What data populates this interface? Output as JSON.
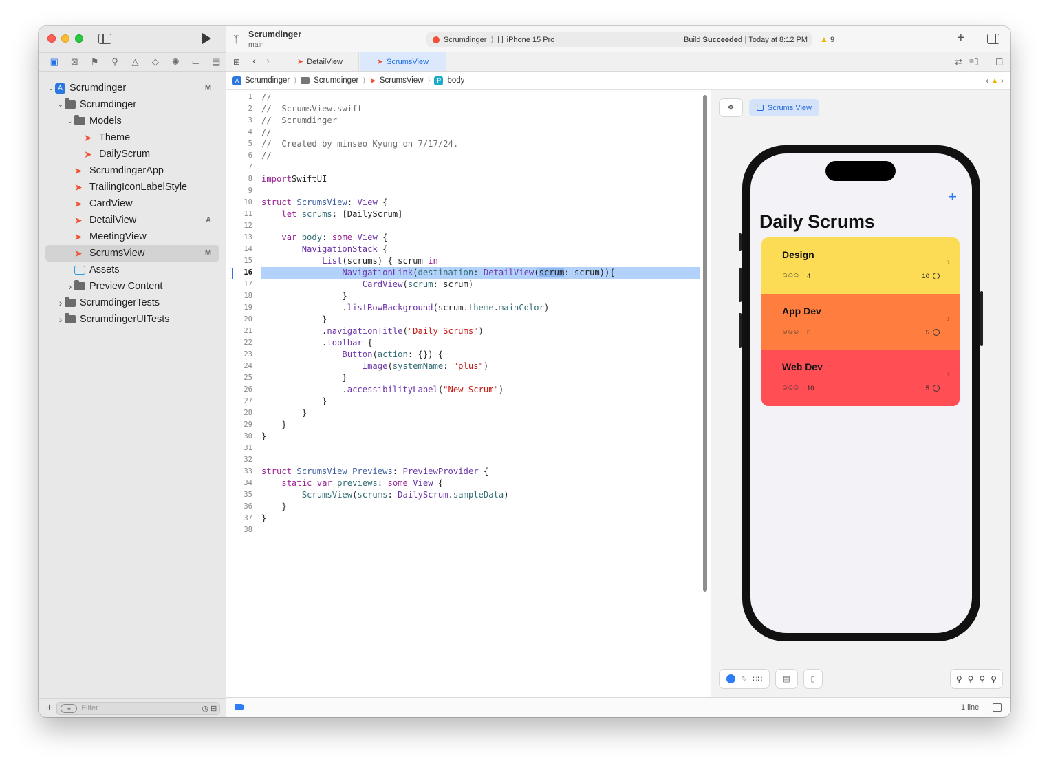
{
  "sidebar": {
    "nav_tabs": [
      "folder-icon",
      "source-control-icon",
      "bookmark-icon",
      "find-icon",
      "issues-icon",
      "tests-icon",
      "debug-icon",
      "breakpoints-icon",
      "reports-icon"
    ],
    "tree": [
      {
        "label": "Scrumdinger",
        "level": 0,
        "kind": "project",
        "badge": "M",
        "expanded": true
      },
      {
        "label": "Scrumdinger",
        "level": 1,
        "kind": "folder",
        "badge": "",
        "expanded": true
      },
      {
        "label": "Models",
        "level": 2,
        "kind": "folder",
        "badge": "",
        "expanded": true
      },
      {
        "label": "Theme",
        "level": 3,
        "kind": "swift",
        "badge": ""
      },
      {
        "label": "DailyScrum",
        "level": 3,
        "kind": "swift",
        "badge": ""
      },
      {
        "label": "ScrumdingerApp",
        "level": 2,
        "kind": "swift",
        "badge": ""
      },
      {
        "label": "TrailingIconLabelStyle",
        "level": 2,
        "kind": "swift",
        "badge": ""
      },
      {
        "label": "CardView",
        "level": 2,
        "kind": "swift",
        "badge": ""
      },
      {
        "label": "DetailView",
        "level": 2,
        "kind": "swift",
        "badge": "A"
      },
      {
        "label": "MeetingView",
        "level": 2,
        "kind": "swift",
        "badge": ""
      },
      {
        "label": "ScrumsView",
        "level": 2,
        "kind": "swift",
        "badge": "M",
        "selected": true
      },
      {
        "label": "Assets",
        "level": 2,
        "kind": "assets",
        "badge": ""
      },
      {
        "label": "Preview Content",
        "level": 2,
        "kind": "folder",
        "badge": "",
        "collapsed": true
      },
      {
        "label": "ScrumdingerTests",
        "level": 1,
        "kind": "folder",
        "badge": "",
        "collapsed": true
      },
      {
        "label": "ScrumdingerUITests",
        "level": 1,
        "kind": "folder",
        "badge": "",
        "collapsed": true
      }
    ],
    "filter_placeholder": "Filter"
  },
  "toolbar": {
    "project_name": "Scrumdinger",
    "branch": "main",
    "scheme": "Scrumdinger",
    "device": "iPhone 15 Pro",
    "status_prefix": "Build",
    "status_bold": "Succeeded",
    "status_suffix": "| Today at 8:12 PM",
    "warning_count": "9"
  },
  "tabs": [
    {
      "label": "DetailView",
      "active": false
    },
    {
      "label": "ScrumsView",
      "active": true
    }
  ],
  "jumpbar": [
    "Scrumdinger",
    "Scrumdinger",
    "ScrumsView",
    "body"
  ],
  "code_lines": [
    [
      [
        "c-cm",
        "//"
      ]
    ],
    [
      [
        "c-cm",
        "//  ScrumsView.swift"
      ]
    ],
    [
      [
        "c-cm",
        "//  Scrumdinger"
      ]
    ],
    [
      [
        "c-cm",
        "//"
      ]
    ],
    [
      [
        "c-cm",
        "//  Created by minseo Kyung on 7/17/24."
      ]
    ],
    [
      [
        "c-cm",
        "//"
      ]
    ],
    [],
    [
      [
        "c-kw",
        "import"
      ],
      [
        "",
        "SwiftUI"
      ]
    ],
    [],
    [
      [
        "c-kw",
        "struct"
      ],
      [
        "",
        " "
      ],
      [
        "c-ty",
        "ScrumsView"
      ],
      [
        "",
        ": "
      ],
      [
        "c-pr",
        "View"
      ],
      [
        "",
        " {"
      ]
    ],
    [
      [
        "",
        "    "
      ],
      [
        "c-kw",
        "let"
      ],
      [
        "",
        " "
      ],
      [
        "c-fn",
        "scrums"
      ],
      [
        "",
        ": [DailyScrum]"
      ]
    ],
    [],
    [
      [
        "",
        "    "
      ],
      [
        "c-kw",
        "var"
      ],
      [
        "",
        " "
      ],
      [
        "c-fn",
        "body"
      ],
      [
        "",
        ": "
      ],
      [
        "c-kw",
        "some"
      ],
      [
        "",
        " "
      ],
      [
        "c-pr",
        "View"
      ],
      [
        "",
        " {"
      ]
    ],
    [
      [
        "",
        "        "
      ],
      [
        "c-pr",
        "NavigationStack"
      ],
      [
        "",
        " {"
      ]
    ],
    [
      [
        "",
        "            "
      ],
      [
        "c-pr",
        "List"
      ],
      [
        "",
        "(scrums) { scrum "
      ],
      [
        "c-kw",
        "in"
      ]
    ],
    [
      [
        "",
        "                "
      ],
      [
        "c-pr",
        "NavigationLink"
      ],
      [
        "",
        "("
      ],
      [
        "c-fn",
        "destination"
      ],
      [
        "",
        ": "
      ],
      [
        "c-pr",
        "DetailView"
      ],
      [
        "",
        "("
      ],
      [
        "c-sel",
        "scrum"
      ],
      [
        "",
        ": scrum)){"
      ]
    ],
    [
      [
        "",
        "                    "
      ],
      [
        "c-pr",
        "CardView"
      ],
      [
        "",
        "("
      ],
      [
        "c-fn",
        "scrum"
      ],
      [
        "",
        ": scrum)"
      ]
    ],
    [
      [
        "",
        "                }"
      ]
    ],
    [
      [
        "",
        "                ."
      ],
      [
        "c-pr",
        "listRowBackground"
      ],
      [
        "",
        "(scrum."
      ],
      [
        "c-fn",
        "theme"
      ],
      [
        "",
        "."
      ],
      [
        "c-fn",
        "mainColor"
      ],
      [
        "",
        ")"
      ]
    ],
    [
      [
        "",
        "            }"
      ]
    ],
    [
      [
        "",
        "            ."
      ],
      [
        "c-pr",
        "navigationTitle"
      ],
      [
        "",
        "("
      ],
      [
        "c-st",
        "\"Daily Scrums\""
      ],
      [
        "",
        ")"
      ]
    ],
    [
      [
        "",
        "            ."
      ],
      [
        "c-pr",
        "toolbar"
      ],
      [
        "",
        " {"
      ]
    ],
    [
      [
        "",
        "                "
      ],
      [
        "c-pr",
        "Button"
      ],
      [
        "",
        "("
      ],
      [
        "c-fn",
        "action"
      ],
      [
        "",
        ": {}) {"
      ]
    ],
    [
      [
        "",
        "                    "
      ],
      [
        "c-pr",
        "Image"
      ],
      [
        "",
        "("
      ],
      [
        "c-fn",
        "systemName"
      ],
      [
        "",
        ": "
      ],
      [
        "c-st",
        "\"plus\""
      ],
      [
        "",
        ")"
      ]
    ],
    [
      [
        "",
        "                }"
      ]
    ],
    [
      [
        "",
        "                ."
      ],
      [
        "c-pr",
        "accessibilityLabel"
      ],
      [
        "",
        "("
      ],
      [
        "c-st",
        "\"New Scrum\""
      ],
      [
        "",
        ")"
      ]
    ],
    [
      [
        "",
        "            }"
      ]
    ],
    [
      [
        "",
        "        }"
      ]
    ],
    [
      [
        "",
        "    }"
      ]
    ],
    [
      [
        "",
        "}"
      ]
    ],
    [],
    [],
    [
      [
        "c-kw",
        "struct"
      ],
      [
        "",
        " "
      ],
      [
        "c-ty",
        "ScrumsView_Previews"
      ],
      [
        "",
        ": "
      ],
      [
        "c-pr",
        "PreviewProvider"
      ],
      [
        "",
        " {"
      ]
    ],
    [
      [
        "",
        "    "
      ],
      [
        "c-kw",
        "static"
      ],
      [
        "",
        " "
      ],
      [
        "c-kw",
        "var"
      ],
      [
        "",
        " "
      ],
      [
        "c-fn",
        "previews"
      ],
      [
        "",
        ": "
      ],
      [
        "c-kw",
        "some"
      ],
      [
        "",
        " "
      ],
      [
        "c-pr",
        "View"
      ],
      [
        "",
        " {"
      ]
    ],
    [
      [
        "",
        "        "
      ],
      [
        "c-fn",
        "ScrumsView"
      ],
      [
        "",
        "("
      ],
      [
        "c-fn",
        "scrums"
      ],
      [
        "",
        ": "
      ],
      [
        "c-pr",
        "DailyScrum"
      ],
      [
        "",
        "."
      ],
      [
        "c-fn",
        "sampleData"
      ],
      [
        "",
        ")"
      ]
    ],
    [
      [
        "",
        "    }"
      ]
    ],
    [
      [
        "",
        "}"
      ]
    ],
    []
  ],
  "highlighted_line": 16,
  "preview": {
    "chip_label": "Scrums View",
    "title": "Daily Scrums",
    "scrums": [
      {
        "title": "Design",
        "attendees": "4",
        "length": "10",
        "color": "#fcdb55"
      },
      {
        "title": "App Dev",
        "attendees": "5",
        "length": "5",
        "color": "#ff7e3f"
      },
      {
        "title": "Web Dev",
        "attendees": "10",
        "length": "5",
        "color": "#ff4f55"
      }
    ]
  },
  "debug": {
    "lines_label": "1 line"
  }
}
